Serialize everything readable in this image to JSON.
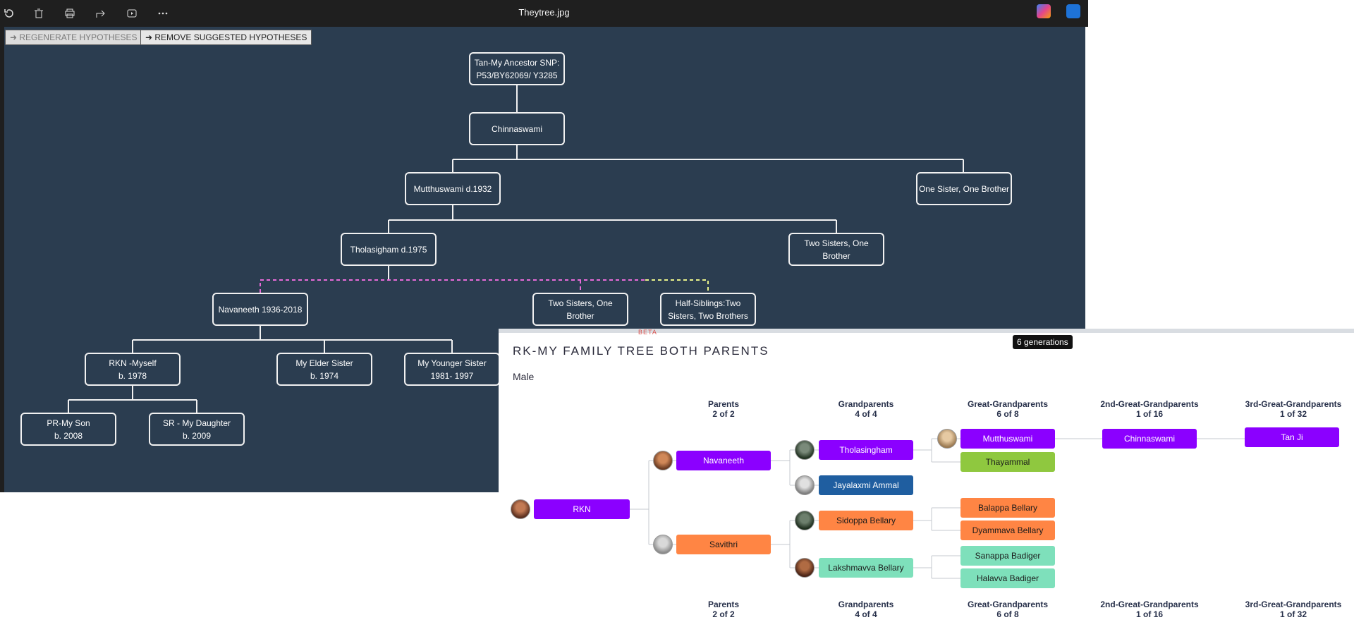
{
  "toolbar": {
    "title": "Theytree.jpg",
    "tools": [
      "rotate-icon",
      "delete-icon",
      "print-icon",
      "share-icon",
      "slideshow-icon",
      "more-icon"
    ],
    "apps": [
      "copilot-icon",
      "editor-icon"
    ]
  },
  "buttons": {
    "regenerate": "➜ REGENERATE HYPOTHESES",
    "remove": "➜ REMOVE SUGGESTED HYPOTHESES"
  },
  "tree": {
    "ancestor": "Tan-My Ancestor SNP:\nP53/BY62069/ Y3285",
    "chinnaswami": "Chinnaswami",
    "mutthuswami": "Mutthuswami d.1932",
    "one_sister_brother": "One Sister, One Brother",
    "tholasigham": "Tholasigham d.1975",
    "two_sisters_1": "Two Sisters, One\nBrother",
    "navaneeth": "Navaneeth 1936-2018",
    "two_sisters_2": "Two Sisters, One\nBrother",
    "half_siblings": "Half-Siblings:Two\nSisters, Two Brothers",
    "rkn": "RKN -Myself\nb. 1978",
    "elder_sister": "My Elder Sister\nb. 1974",
    "younger_sister": "My Younger Sister\n1981- 1997",
    "son": "PR-My Son\nb. 2008",
    "daughter": "SR - My Daughter\nb. 2009"
  },
  "pedigree": {
    "beta": "BETA",
    "title": "RK-MY FAMILY TREE BOTH PARENTS",
    "sex": "Male",
    "tooltip": "6 generations",
    "generations": [
      {
        "label": "Parents",
        "count": "2 of 2"
      },
      {
        "label": "Grandparents",
        "count": "4 of 4"
      },
      {
        "label": "Great-Grandparents",
        "count": "6 of 8"
      },
      {
        "label": "2nd-Great-Grandparents",
        "count": "1 of 16"
      },
      {
        "label": "3rd-Great-Grandparents",
        "count": "1 of 32"
      }
    ],
    "people": {
      "rkn": "RKN",
      "navaneeth": "Navaneeth",
      "savithri": "Savithri",
      "tholasingham": "Tholasingham",
      "jayalaxmi": "Jayalaxmi Ammal",
      "sidoppa": "Sidoppa Bellary",
      "lakshmavva": "Lakshmavva Bellary",
      "mutthuswami": "Mutthuswami",
      "thayammal": "Thayammal",
      "balappa": "Balappa Bellary",
      "dyammava": "Dyammava Bellary",
      "sanappa": "Sanappa Badiger",
      "halavva": "Halavva Badiger",
      "chinnaswami": "Chinnaswami",
      "tan_ji": "Tan Ji"
    },
    "colors": {
      "purple": "#8b00ff",
      "orange": "#ff8544",
      "blue": "#1f5ea0",
      "green": "#8fc83f",
      "mint": "#7ee0bb"
    }
  }
}
